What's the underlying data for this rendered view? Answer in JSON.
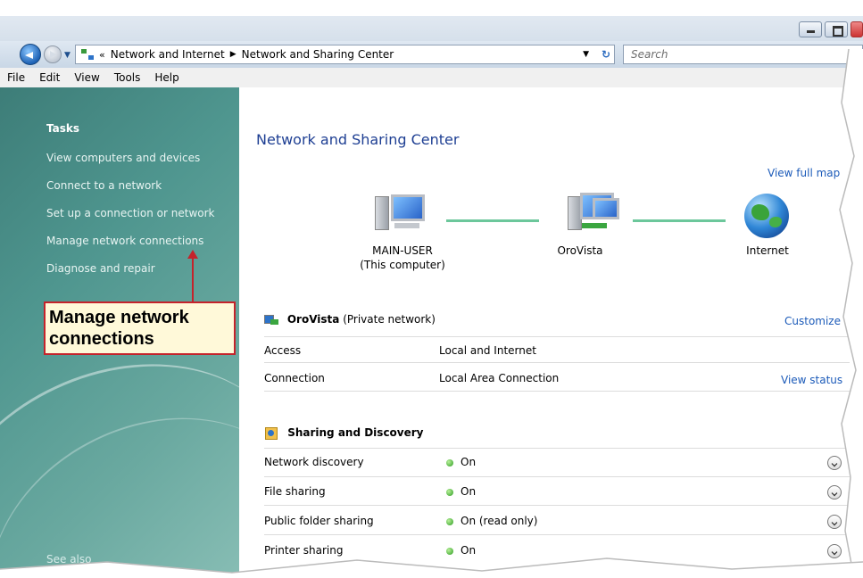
{
  "address": {
    "crumbs": [
      "Network and Internet",
      "Network and Sharing Center"
    ],
    "search_placeholder": "Search"
  },
  "menu": [
    "File",
    "Edit",
    "View",
    "Tools",
    "Help"
  ],
  "sidebar": {
    "tasks_title": "Tasks",
    "items": [
      "View computers and devices",
      "Connect to a network",
      "Set up a connection or network",
      "Manage network connections",
      "Diagnose and repair"
    ],
    "see_also": "See also"
  },
  "callout": {
    "label": "Manage network connections",
    "colors": {
      "border": "#c4232b",
      "fill": "#fff9d9"
    }
  },
  "main": {
    "title": "Network and Sharing Center",
    "view_full_map": "View full map",
    "map": {
      "computer_name": "MAIN-USER",
      "computer_sub": "(This computer)",
      "network_name": "OroVista",
      "internet_label": "Internet"
    },
    "network": {
      "name": "OroVista",
      "type": "(Private network)",
      "customize": "Customize",
      "rows": [
        {
          "label": "Access",
          "value": "Local and Internet",
          "link": ""
        },
        {
          "label": "Connection",
          "value": "Local Area Connection",
          "link": "View status"
        }
      ]
    },
    "sharing": {
      "title": "Sharing and Discovery",
      "rows": [
        {
          "label": "Network discovery",
          "value": "On"
        },
        {
          "label": "File sharing",
          "value": "On"
        },
        {
          "label": "Public folder sharing",
          "value": "On (read only)"
        },
        {
          "label": "Printer sharing",
          "value": "On"
        }
      ]
    }
  }
}
